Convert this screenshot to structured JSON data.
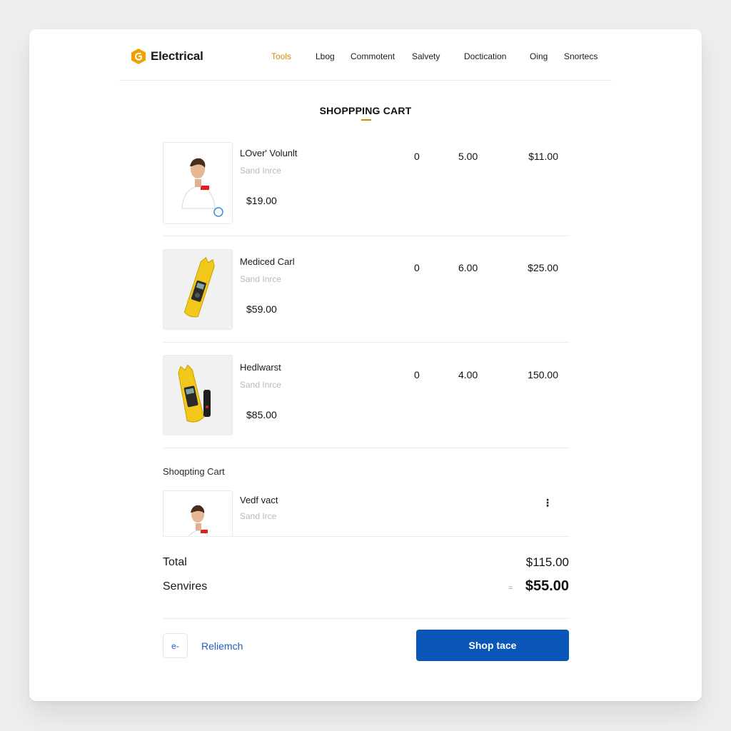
{
  "brand": {
    "name": "Electrical",
    "accent": "#d18b00",
    "primary": "#0a57b8"
  },
  "nav": [
    {
      "label": "Tools",
      "active": true
    },
    {
      "label": "Lbog",
      "active": false
    },
    {
      "label": "Commotent",
      "active": false
    },
    {
      "label": "Salvety",
      "active": false
    },
    {
      "label": "Doctication",
      "active": false
    },
    {
      "label": "Oing",
      "active": false
    },
    {
      "label": "Snortecs",
      "active": false
    }
  ],
  "cart": {
    "title": "SHOPPPING CART",
    "items": [
      {
        "name": "LOver' Volunlt",
        "subtitle": "Sand Inrce",
        "price": "$19.00",
        "qty": "0",
        "unit": "5.00",
        "total": "$11.00",
        "image": "person-icon"
      },
      {
        "name": "Mediced Carl",
        "subtitle": "Sand Inrce",
        "price": "$59.00",
        "qty": "0",
        "unit": "6.00",
        "total": "$25.00",
        "image": "clamp-meter-icon"
      },
      {
        "name": "Hedlwarst",
        "subtitle": "Sand Inrce",
        "price": "$85.00",
        "qty": "0",
        "unit": "4.00",
        "total": "150.00",
        "image": "clamp-meter-icon"
      }
    ],
    "section_label": "Shoqpting Cart",
    "extra_item": {
      "name": "Vedf vact",
      "subtitle": "Sand Irce",
      "image": "person-icon"
    }
  },
  "summary": {
    "total_label": "Total",
    "total_value": "$115.00",
    "services_label": "Senvires",
    "services_prefix": "=",
    "services_value": "$55.00"
  },
  "actions": {
    "back_label": "e-",
    "link_label": "Reliemch",
    "primary_label": "Shop tace"
  }
}
